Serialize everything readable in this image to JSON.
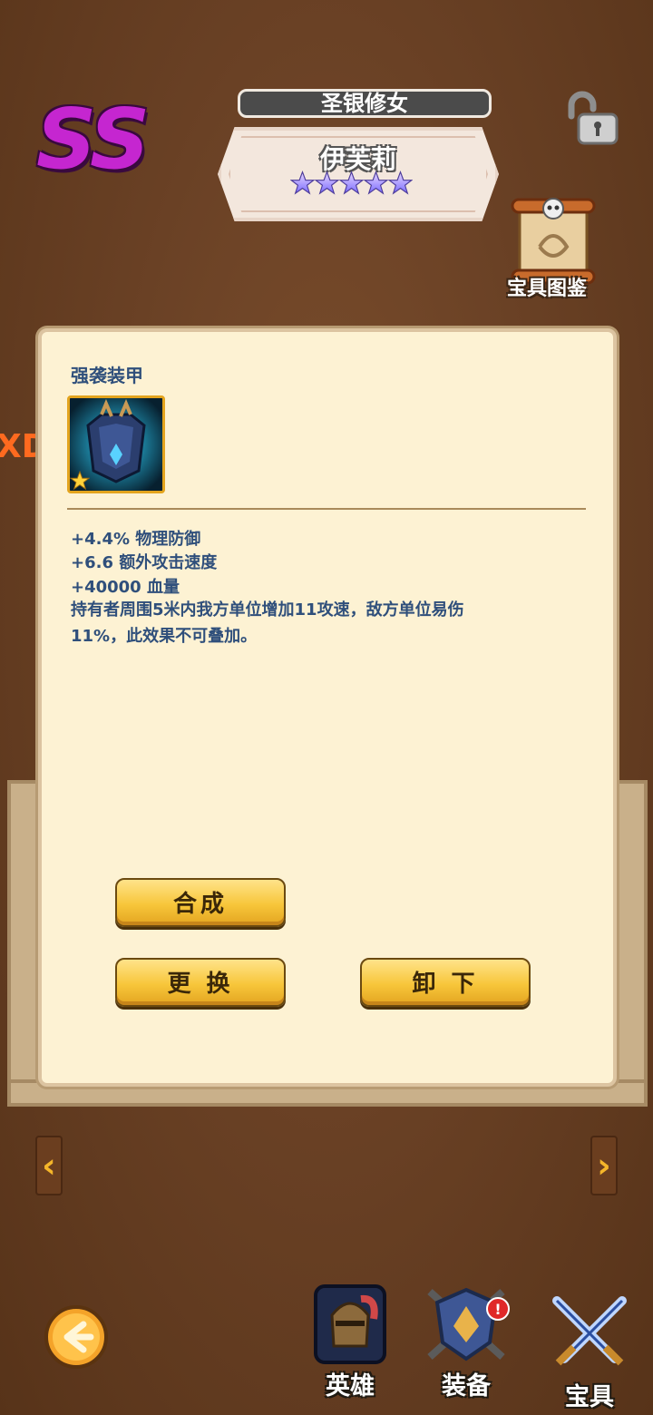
{
  "header": {
    "rank": "SS",
    "title": "圣银修女",
    "hero_name": "伊芙莉",
    "star_count": 5
  },
  "codex": {
    "label": "宝具图鉴"
  },
  "edge_text": "XD",
  "item": {
    "name": "强袭装甲",
    "star_count": 1,
    "stats": [
      "+4.4% 物理防御",
      "+6.6 额外攻击速度",
      "+40000 血量"
    ],
    "description": "持有者周围5米内我方单位增加11攻速，敌方单位易伤11%，此效果不可叠加。"
  },
  "buttons": {
    "compose": "合成",
    "replace": "更 换",
    "unequip": "卸 下"
  },
  "arrows": {
    "prev": "‹",
    "next": "›"
  },
  "bottom_nav": {
    "items": [
      {
        "label": "英雄",
        "icon": "knight-helmet-icon"
      },
      {
        "label": "装备",
        "icon": "armor-shield-icon",
        "badge": "!"
      },
      {
        "label": "宝具",
        "icon": "crossed-swords-icon"
      }
    ]
  },
  "colors": {
    "rank": "#c526d0",
    "text_blue": "#2f4f7b",
    "button_gold": "#f7c63a"
  }
}
